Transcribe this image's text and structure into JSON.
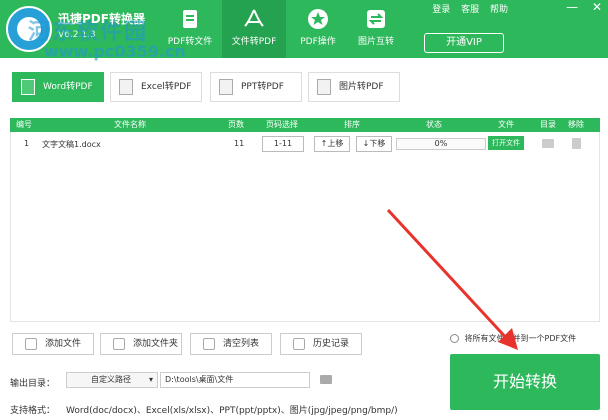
{
  "app": {
    "title": "迅捷PDF转换器",
    "version": "V6.2.1.3",
    "watermark_line1": "河东软件园",
    "watermark_line2": "www.pc0359.cn"
  },
  "header_links": [
    "登录",
    "客服",
    "帮助"
  ],
  "window_controls": [
    "—",
    "✕"
  ],
  "nav_tabs": [
    {
      "label": "PDF转文件",
      "icon": "pdf-to-file-icon"
    },
    {
      "label": "文件转PDF",
      "icon": "file-to-pdf-icon",
      "active": true
    },
    {
      "label": "PDF操作",
      "icon": "star-icon"
    },
    {
      "label": "图片互转",
      "icon": "image-convert-icon"
    }
  ],
  "vip_label": "开通VIP",
  "sub_tabs": [
    {
      "label": "Word转PDF",
      "active": true
    },
    {
      "label": "Excel转PDF"
    },
    {
      "label": "PPT转PDF"
    },
    {
      "label": "图片转PDF"
    }
  ],
  "table": {
    "headers": [
      "编号",
      "文件名称",
      "页数",
      "页码选择",
      "排序",
      "状态",
      "文件",
      "目录",
      "移除"
    ],
    "rows": [
      {
        "index": "1",
        "name": "文字文稿1.docx",
        "pages": "11",
        "range": "1-11",
        "up": "↑上移",
        "down": "↓下移",
        "progress": "0%",
        "open": "打开文件"
      }
    ]
  },
  "actions": [
    "添加文件",
    "添加文件夹",
    "清空列表",
    "历史记录"
  ],
  "merge_label": "将所有文件合并到一个PDF文件",
  "output": {
    "label": "输出目录：",
    "mode": "自定义路径",
    "path": "D:\\tools\\桌面\\文件"
  },
  "support": {
    "label": "支持格式：",
    "value": "Word(doc/docx)、Excel(xls/xlsx)、PPT(ppt/pptx)、图片(jpg/jpeg/png/bmp/)"
  },
  "start_label": "开始转换",
  "colors": {
    "accent": "#2eb85c",
    "arrow": "#e8322c"
  }
}
